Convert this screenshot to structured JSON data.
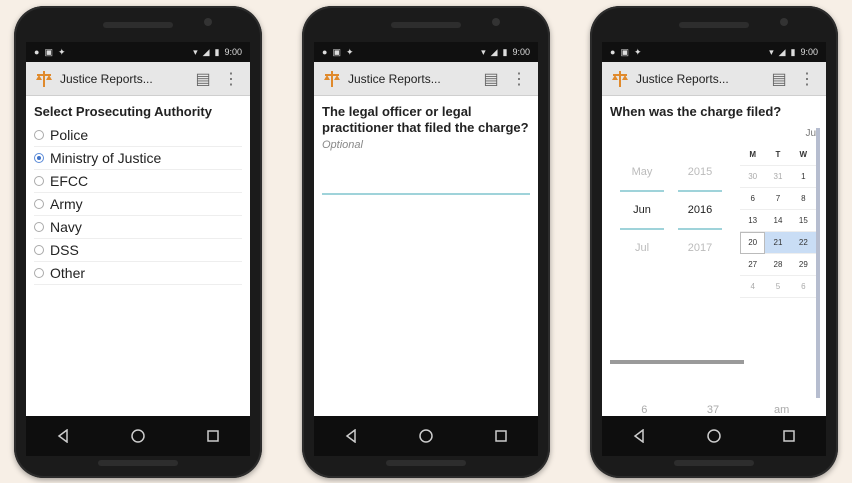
{
  "status_bar": {
    "time": "9:00"
  },
  "app": {
    "title": "Justice Reports..."
  },
  "screen1": {
    "question": "Select Prosecuting Authority",
    "options": [
      {
        "label": "Police",
        "checked": false
      },
      {
        "label": "Ministry of Justice",
        "checked": true
      },
      {
        "label": "EFCC",
        "checked": false
      },
      {
        "label": "Army",
        "checked": false
      },
      {
        "label": "Navy",
        "checked": false
      },
      {
        "label": "DSS",
        "checked": false
      },
      {
        "label": "Other",
        "checked": false
      }
    ]
  },
  "screen2": {
    "question": "The legal officer or legal practitioner that filed the charge?",
    "hint": "Optional",
    "value": ""
  },
  "screen3": {
    "question": "When was the charge filed?",
    "spinner": {
      "months": [
        "May",
        "Jun",
        "Jul"
      ],
      "years": [
        "2015",
        "2016",
        "2017"
      ]
    },
    "calendar": {
      "month_label": "Ju",
      "headers": [
        "M",
        "T",
        "W"
      ],
      "rows": [
        [
          "30",
          "31",
          "1"
        ],
        [
          "6",
          "7",
          "8"
        ],
        [
          "13",
          "14",
          "15"
        ],
        [
          "20",
          "21",
          "22"
        ],
        [
          "27",
          "28",
          "29"
        ],
        [
          "4",
          "5",
          "6"
        ]
      ],
      "selected_row": 3
    },
    "time": {
      "hour": "6",
      "minute": "37",
      "ampm": "am"
    }
  },
  "icons": {
    "logo": "justice-logo-icon",
    "save": "save-icon",
    "menu": "overflow-menu-icon",
    "back": "back-icon",
    "home": "home-icon",
    "recents": "recents-icon"
  },
  "colors": {
    "accent": "#3f73c8",
    "underline": "#9fd3da",
    "logo": "#e08a2c"
  }
}
